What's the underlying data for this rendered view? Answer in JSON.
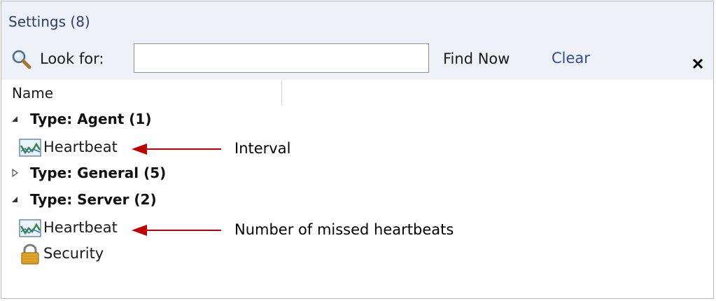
{
  "pane": {
    "title": "Settings (8)"
  },
  "search": {
    "label": "Look for:",
    "value": "",
    "placeholder": "",
    "find_now_label": "Find Now",
    "clear_label": "Clear"
  },
  "columns": [
    {
      "label": "Name"
    }
  ],
  "groups": [
    {
      "label": "Type: Agent (1)",
      "expanded": true,
      "items": [
        {
          "label": "Heartbeat",
          "icon": "chart-icon",
          "annotation": "Interval"
        }
      ]
    },
    {
      "label": "Type: General (5)",
      "expanded": false,
      "items": []
    },
    {
      "label": "Type: Server (2)",
      "expanded": true,
      "items": [
        {
          "label": "Heartbeat",
          "icon": "chart-icon",
          "annotation": "Number of missed heartbeats"
        },
        {
          "label": "Security",
          "icon": "lock-icon"
        }
      ]
    }
  ],
  "colors": {
    "title_text": "#2e3c6e",
    "header_band": "#eef1f8",
    "link": "#2d4c9a",
    "annotation_arrow": "#c00000"
  }
}
